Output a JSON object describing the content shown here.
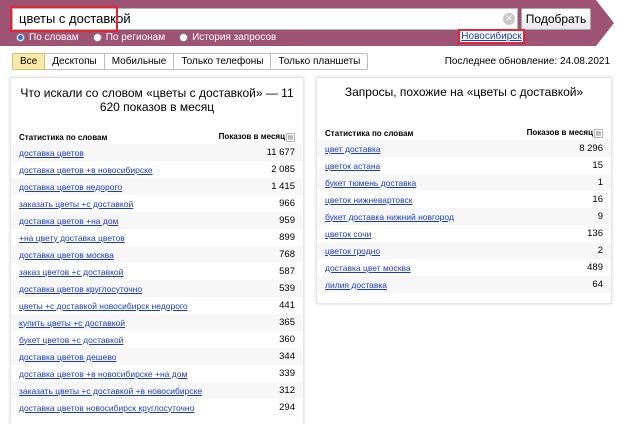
{
  "search": {
    "value": "цветы с доставкой",
    "clear_icon": "clear-icon",
    "submit_label": "Подобрать"
  },
  "modes": [
    {
      "label": "По словам",
      "checked": true
    },
    {
      "label": "По регионам",
      "checked": false
    },
    {
      "label": "История запросов",
      "checked": false
    }
  ],
  "region": {
    "label": "Новосибирск"
  },
  "tabs": [
    "Все",
    "Десктопы",
    "Мобильные",
    "Только телефоны",
    "Только планшеты"
  ],
  "active_tab": "Все",
  "updated": "Последнее обновление: 24.08.2021",
  "left_panel": {
    "title": "Что искали со словом «цветы с доставкой» — 11 620 показов в месяц",
    "col_keyword": "Статистика по словам",
    "col_count": "Показов в месяц",
    "rows": [
      {
        "kw": "доставка цветов",
        "cnt": "11 677"
      },
      {
        "kw": "доставка цветов +в новосибирске",
        "cnt": "2 085"
      },
      {
        "kw": "доставка цветов недорого",
        "cnt": "1 415"
      },
      {
        "kw": "заказать цветы +с доставкой",
        "cnt": "966"
      },
      {
        "kw": "доставка цветов +на дом",
        "cnt": "959"
      },
      {
        "kw": "+на цвету доставка цветов",
        "cnt": "899"
      },
      {
        "kw": "доставка цветов москва",
        "cnt": "768"
      },
      {
        "kw": "заказ цветов +с доставкой",
        "cnt": "587"
      },
      {
        "kw": "доставка цветов круглосуточно",
        "cnt": "539"
      },
      {
        "kw": "цветы +с доставкой новосибирск недорого",
        "cnt": "441"
      },
      {
        "kw": "купить цветы +с доставкой",
        "cnt": "365"
      },
      {
        "kw": "букет цветов +с доставкой",
        "cnt": "360"
      },
      {
        "kw": "доставка цветов дешево",
        "cnt": "344"
      },
      {
        "kw": "доставка цветов +в новосибирске +на дом",
        "cnt": "339"
      },
      {
        "kw": "заказать цветы +с доставкой +в новосибирске",
        "cnt": "312"
      },
      {
        "kw": "доставка цветов новосибирск круглосуточно",
        "cnt": "294"
      }
    ]
  },
  "right_panel": {
    "title": "Запросы, похожие на «цветы с доставкой»",
    "col_keyword": "Статистика по словам",
    "col_count": "Показов в месяц",
    "rows": [
      {
        "kw": "цвет доставка",
        "cnt": "8 296"
      },
      {
        "kw": "цветок астана",
        "cnt": "15"
      },
      {
        "kw": "букет тюмень доставка",
        "cnt": "1"
      },
      {
        "kw": "цветок нижневартовск",
        "cnt": "16"
      },
      {
        "kw": "букет доставка нижний новгород",
        "cnt": "9"
      },
      {
        "kw": "цветок сочи",
        "cnt": "136"
      },
      {
        "kw": "цветок гродно",
        "cnt": "2"
      },
      {
        "kw": "доставка цвет москва",
        "cnt": "489"
      },
      {
        "kw": "лилия доставка",
        "cnt": "64"
      }
    ]
  },
  "colors": {
    "header_band": "#9e5274",
    "highlight": "#e32636",
    "link": "#1a3dc1",
    "active_tab": "#fbe9a8"
  }
}
